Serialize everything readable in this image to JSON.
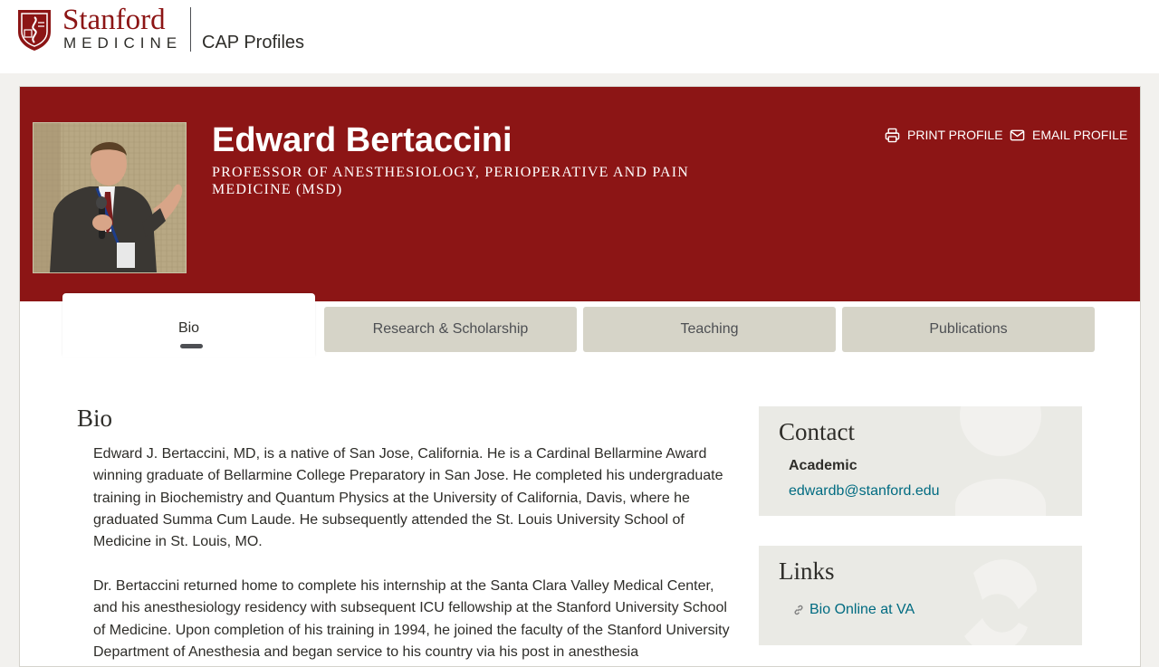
{
  "header": {
    "brand_word": "Stanford",
    "brand_sub": "MEDICINE",
    "app_name": "CAP Profiles"
  },
  "profile": {
    "name": "Edward Bertaccini",
    "title": "PROFESSOR OF ANESTHESIOLOGY, PERIOPERATIVE AND PAIN MEDICINE (MSD)",
    "actions": {
      "print_label": "PRINT PROFILE",
      "email_label": "EMAIL PROFILE"
    }
  },
  "tabs": [
    {
      "label": "Bio",
      "active": true
    },
    {
      "label": "Research & Scholarship",
      "active": false
    },
    {
      "label": "Teaching",
      "active": false
    },
    {
      "label": "Publications",
      "active": false
    }
  ],
  "bio": {
    "heading": "Bio",
    "paragraphs": [
      "Edward J. Bertaccini, MD, is a native of San Jose, California. He is a Cardinal Bellarmine Award winning graduate of Bellarmine College Preparatory in San Jose. He completed his undergraduate training in Biochemistry and Quantum Physics at the University of California, Davis, where he graduated Summa Cum Laude. He subsequently attended the St. Louis University School of Medicine in St. Louis, MO.",
      "Dr. Bertaccini returned home to complete his internship at the Santa Clara Valley Medical Center, and his anesthesiology residency with subsequent ICU fellowship at the Stanford University School of Medicine. Upon completion of his training in 1994, he joined the faculty of the Stanford University Department of Anesthesia and began service to his country via his post in anesthesia"
    ]
  },
  "contact": {
    "heading": "Contact",
    "label": "Academic",
    "email": "edwardb@stanford.edu"
  },
  "links": {
    "heading": "Links",
    "items": [
      {
        "label": "Bio Online at VA"
      }
    ]
  },
  "colors": {
    "brand": "#8c1515",
    "tab_bg": "#d6d4c8",
    "link": "#006b81",
    "sidebar_bg": "#eaeae5"
  },
  "icons": {
    "print": "printer-icon",
    "email": "envelope-icon",
    "link": "link-icon"
  }
}
